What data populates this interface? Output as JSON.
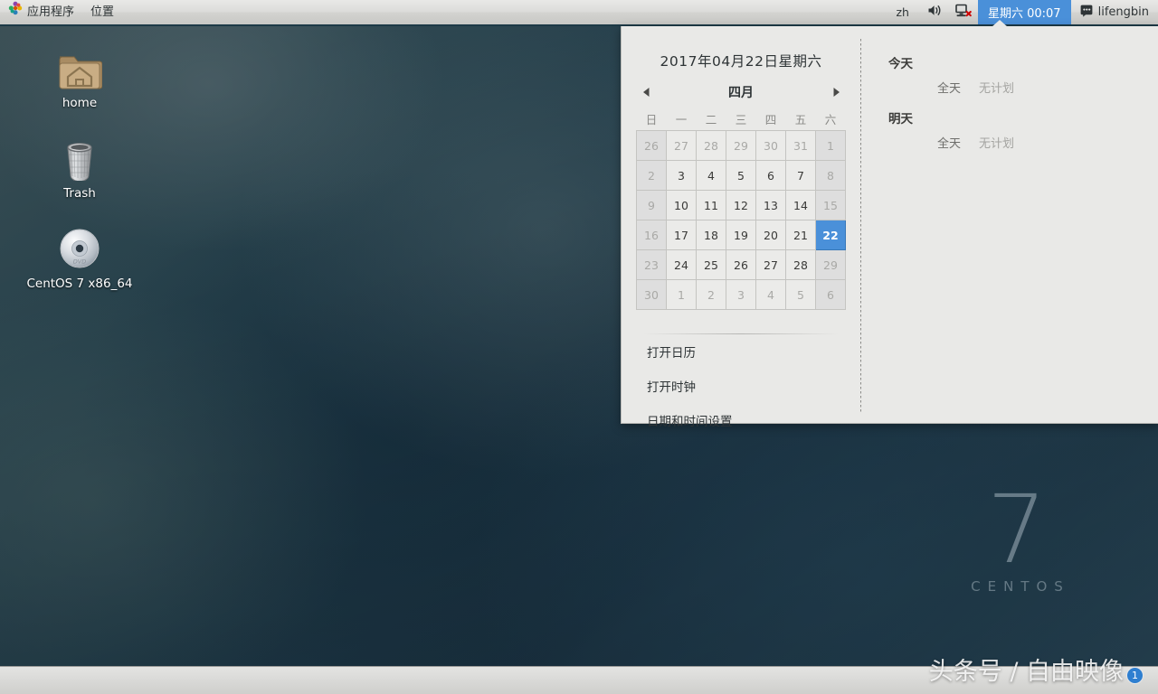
{
  "top_panel": {
    "apps_menu": "应用程序",
    "places_menu": "位置",
    "apps_icon": "gnome-applications-icon",
    "language": "zh",
    "volume_icon": "volume-speaker-icon",
    "network_icon": "network-disconnected-icon",
    "clock": "星期六  00:07",
    "user_name": "lifengbin",
    "user_icon": "chat-bubble-icon"
  },
  "desktop": {
    "icons": [
      {
        "label": "home",
        "icon": "home-folder-icon"
      },
      {
        "label": "Trash",
        "icon": "trash-bin-icon"
      },
      {
        "label": "CentOS 7 x86_64",
        "icon": "dvd-disc-icon"
      }
    ],
    "branding": {
      "number": "7",
      "name": "CENTOS"
    }
  },
  "calendar_popup": {
    "title": "2017年04月22日星期六",
    "month": "四月",
    "prev_icon": "triangle-left-icon",
    "next_icon": "triangle-right-icon",
    "weekday_headers": [
      "日",
      "一",
      "二",
      "三",
      "四",
      "五",
      "六"
    ],
    "weeks": [
      [
        {
          "d": "26",
          "state": "other weekend"
        },
        {
          "d": "27",
          "state": "other"
        },
        {
          "d": "28",
          "state": "other"
        },
        {
          "d": "29",
          "state": "other"
        },
        {
          "d": "30",
          "state": "other"
        },
        {
          "d": "31",
          "state": "other"
        },
        {
          "d": "1",
          "state": "weekend"
        }
      ],
      [
        {
          "d": "2",
          "state": "weekend"
        },
        {
          "d": "3",
          "state": ""
        },
        {
          "d": "4",
          "state": ""
        },
        {
          "d": "5",
          "state": ""
        },
        {
          "d": "6",
          "state": ""
        },
        {
          "d": "7",
          "state": ""
        },
        {
          "d": "8",
          "state": "weekend"
        }
      ],
      [
        {
          "d": "9",
          "state": "weekend"
        },
        {
          "d": "10",
          "state": ""
        },
        {
          "d": "11",
          "state": ""
        },
        {
          "d": "12",
          "state": ""
        },
        {
          "d": "13",
          "state": ""
        },
        {
          "d": "14",
          "state": ""
        },
        {
          "d": "15",
          "state": "weekend"
        }
      ],
      [
        {
          "d": "16",
          "state": "weekend"
        },
        {
          "d": "17",
          "state": ""
        },
        {
          "d": "18",
          "state": ""
        },
        {
          "d": "19",
          "state": ""
        },
        {
          "d": "20",
          "state": ""
        },
        {
          "d": "21",
          "state": ""
        },
        {
          "d": "22",
          "state": "today"
        }
      ],
      [
        {
          "d": "23",
          "state": "weekend"
        },
        {
          "d": "24",
          "state": ""
        },
        {
          "d": "25",
          "state": ""
        },
        {
          "d": "26",
          "state": ""
        },
        {
          "d": "27",
          "state": ""
        },
        {
          "d": "28",
          "state": ""
        },
        {
          "d": "29",
          "state": "weekend"
        }
      ],
      [
        {
          "d": "30",
          "state": "weekend"
        },
        {
          "d": "1",
          "state": "other"
        },
        {
          "d": "2",
          "state": "other"
        },
        {
          "d": "3",
          "state": "other"
        },
        {
          "d": "4",
          "state": "other"
        },
        {
          "d": "5",
          "state": "other"
        },
        {
          "d": "6",
          "state": "other weekend"
        }
      ]
    ],
    "actions": [
      "打开日历",
      "打开时钟",
      "日期和时间设置"
    ],
    "events": [
      {
        "day": "今天",
        "time": "全天",
        "text": "无计划"
      },
      {
        "day": "明天",
        "time": "全天",
        "text": "无计划"
      }
    ]
  },
  "watermark": {
    "text": "头条号 / 自由映像",
    "badge": "1"
  },
  "colors": {
    "accent_blue": "#4a90d9",
    "panel_gray": "#dcdcda",
    "popup_bg": "#e9e9e7",
    "panel_border": "#1d3a47"
  }
}
